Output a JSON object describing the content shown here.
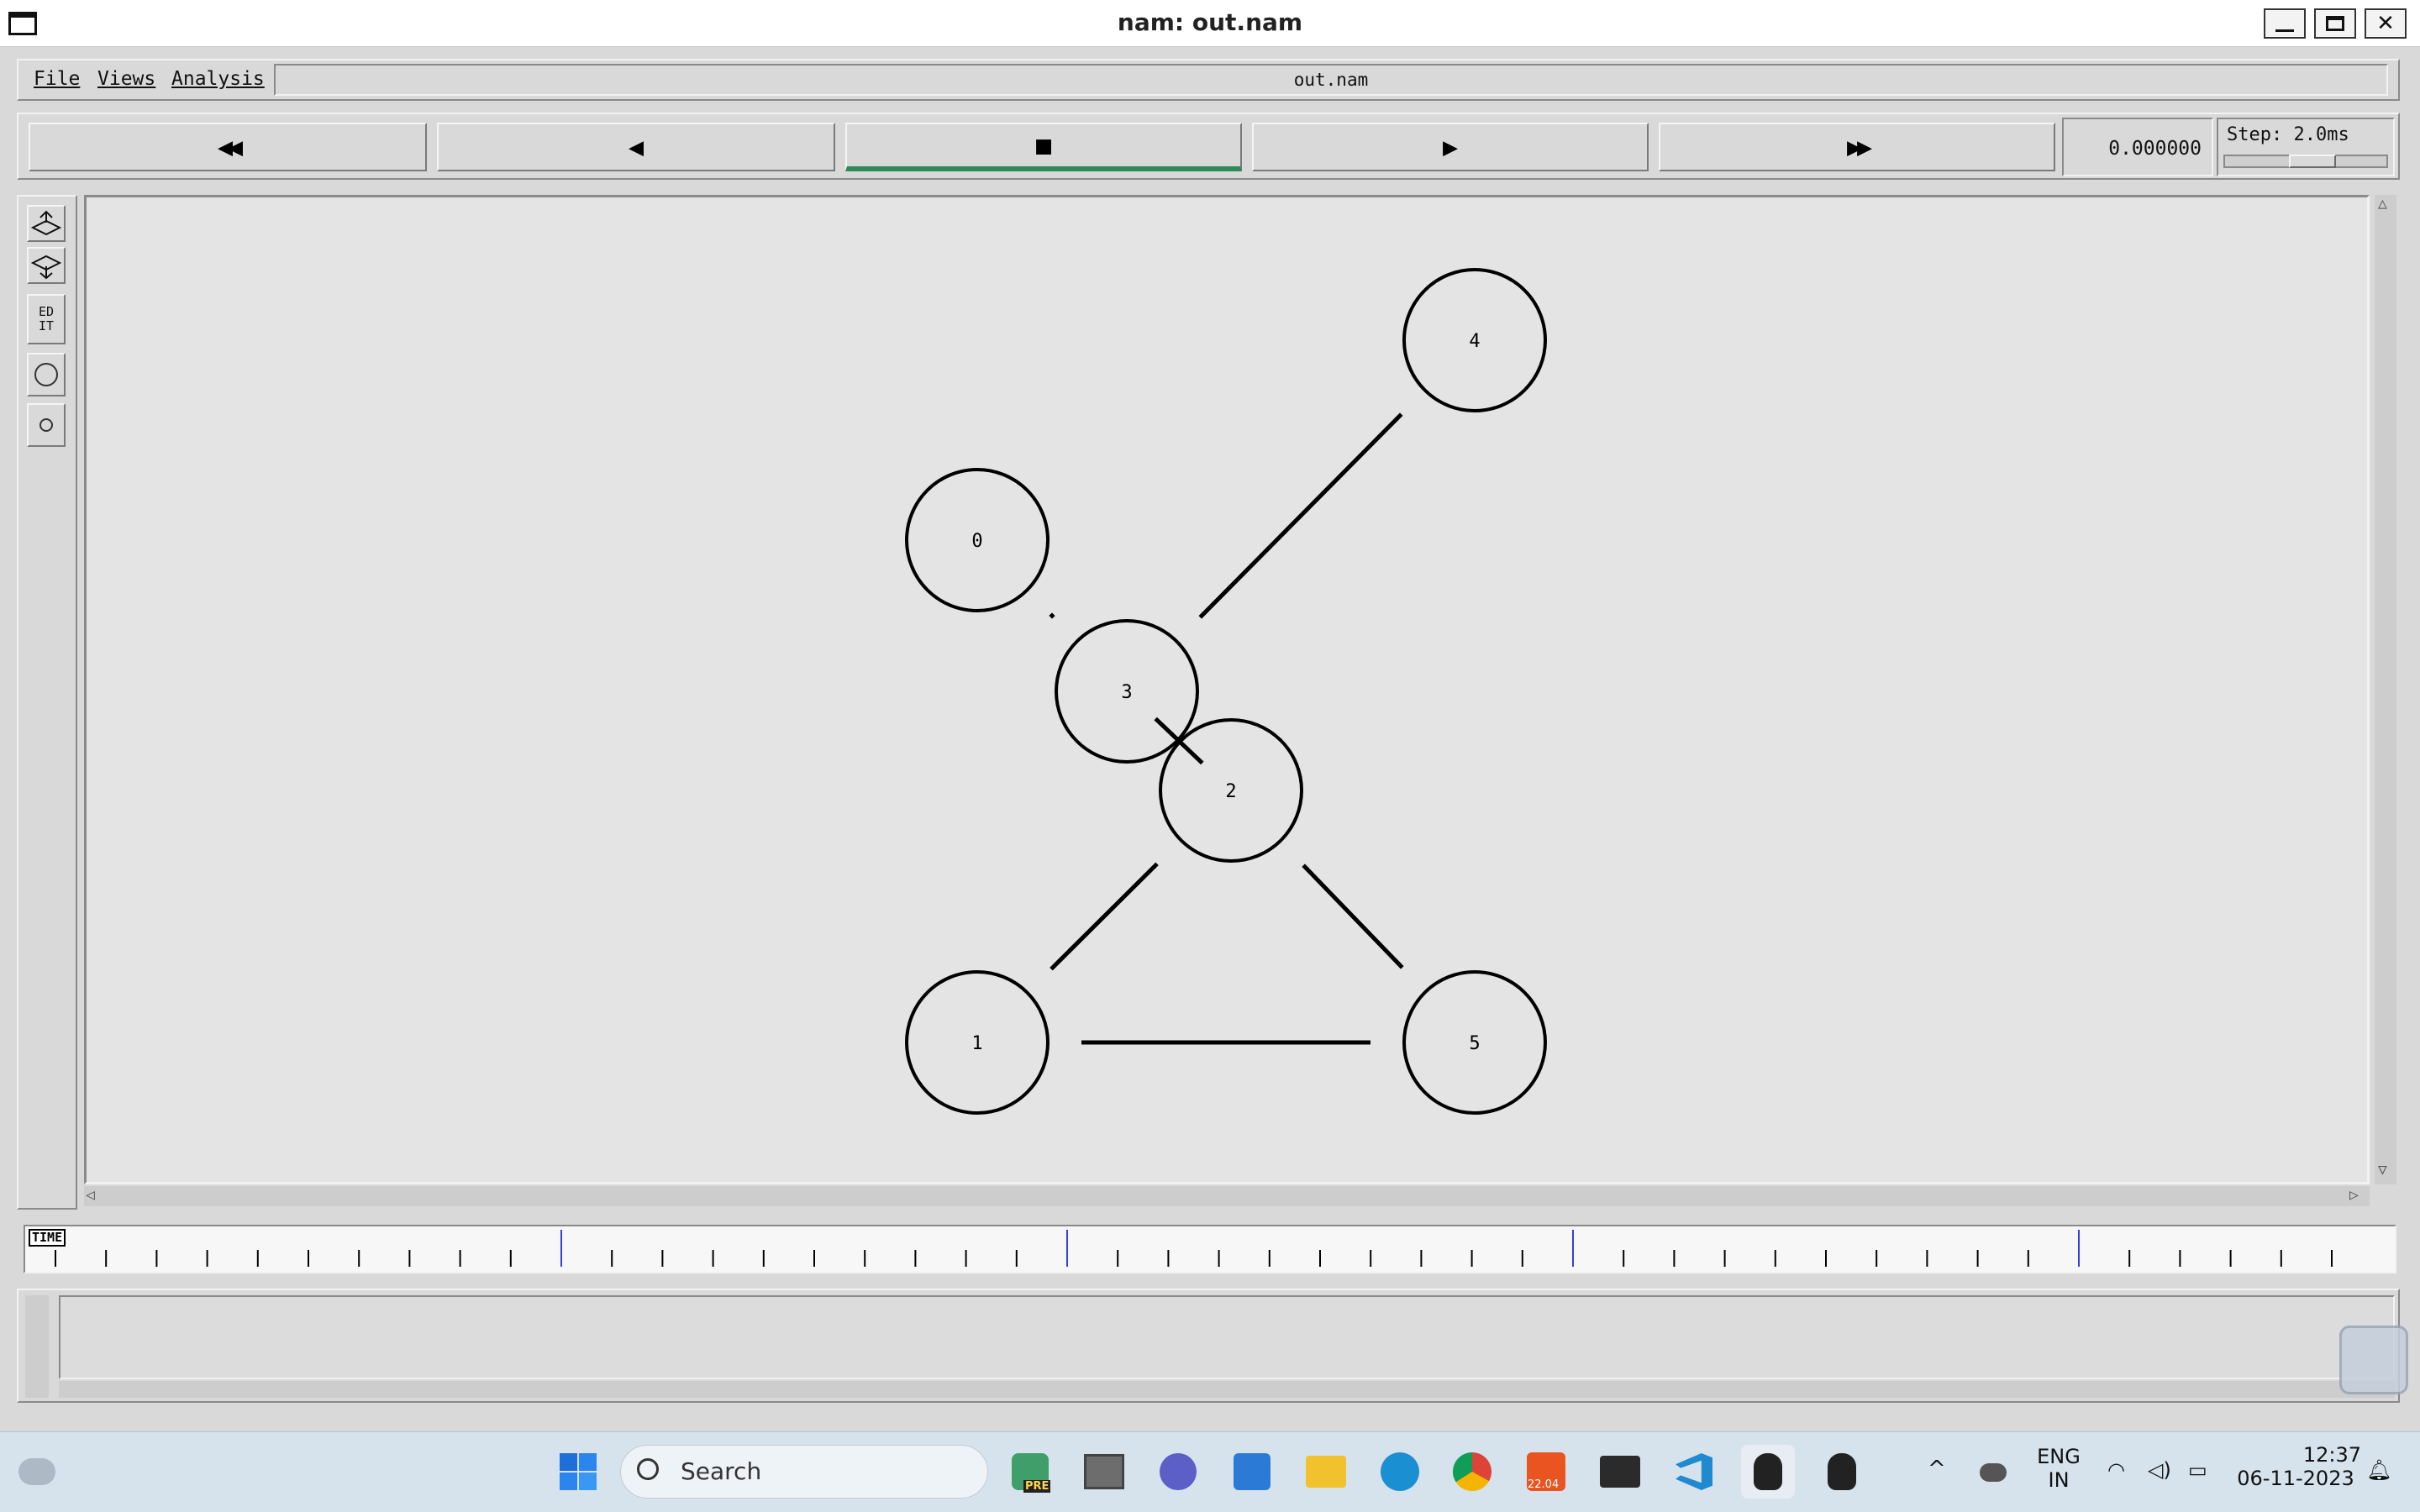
{
  "window": {
    "title": "nam: out.nam"
  },
  "menu": {
    "items": [
      "File",
      "Views",
      "Analysis"
    ],
    "filename": "out.nam"
  },
  "transport": {
    "buttons": [
      {
        "name": "fast-rewind-icon",
        "glyph": "◀◀"
      },
      {
        "name": "rewind-icon",
        "glyph": "◀"
      },
      {
        "name": "stop-icon",
        "glyph": "■"
      },
      {
        "name": "play-icon",
        "glyph": "▶"
      },
      {
        "name": "fast-forward-icon",
        "glyph": "▶▶"
      }
    ],
    "active_index": 2,
    "active_color": "#2e8b57",
    "time": "0.000000",
    "step": "Step: 2.0ms"
  },
  "tools": {
    "edit": "ED\nIT"
  },
  "network": {
    "nodes": [
      {
        "label": "0"
      },
      {
        "label": "1"
      },
      {
        "label": "2"
      },
      {
        "label": "3"
      },
      {
        "label": "4"
      },
      {
        "label": "5"
      }
    ],
    "links": [
      [
        "0",
        "3"
      ],
      [
        "3",
        "4"
      ],
      [
        "3",
        "2"
      ],
      [
        "2",
        "1"
      ],
      [
        "2",
        "5"
      ],
      [
        "1",
        "5"
      ]
    ]
  },
  "timeline": {
    "label": "TIME"
  },
  "taskbar": {
    "search_placeholder": "Search",
    "badge_pre": "PRE",
    "badge_version": "22.04",
    "lang_line1": "ENG",
    "lang_line2": "IN",
    "clock_time": "12:37",
    "clock_date": "06-11-2023"
  }
}
